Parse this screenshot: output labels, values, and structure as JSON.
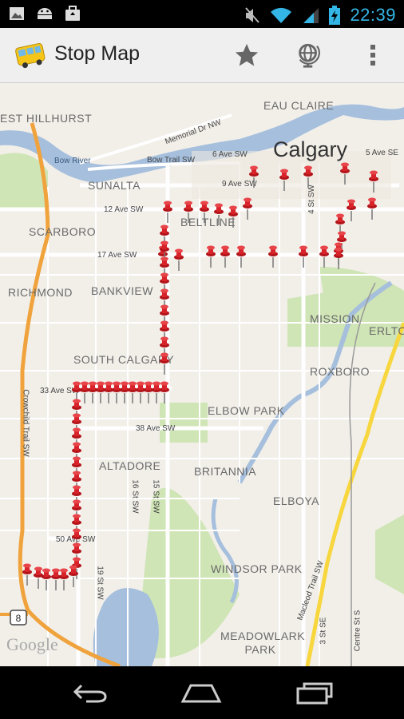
{
  "status_bar": {
    "time": "22:39",
    "left_icons": [
      "gallery-icon",
      "android-icon",
      "briefcase-icon"
    ],
    "right_icons": [
      "mute-icon",
      "wifi-icon",
      "signal-icon",
      "battery-charging-icon"
    ]
  },
  "action_bar": {
    "title": "Stop Map",
    "icons": [
      "bus-app-icon",
      "star-icon",
      "globe-icon",
      "overflow-menu-icon"
    ]
  },
  "map": {
    "city": "Calgary",
    "neighborhoods": [
      "EAU CLAIRE",
      "EST HILLHURST",
      "SUNALTA",
      "BELTLINE",
      "SCARBORO",
      "RICHMOND",
      "BANKVIEW",
      "MISSION",
      "ERLTON",
      "SOUTH CALGARY",
      "ROXBORO",
      "ELBOW PARK",
      "ALTADORE",
      "BRITANNIA",
      "ELBOYA",
      "WINDSOR PARK",
      "MEADOWLARK PARK"
    ],
    "streets": [
      "Bow River",
      "Memorial Dr NW",
      "Bow Trail SW",
      "6 Ave SW",
      "5 Ave SE",
      "9 Ave SW",
      "12 Ave SW",
      "17 Ave SW",
      "33 Ave SW",
      "38 Ave SW",
      "50 Ave SW",
      "Crowchild Trail SW",
      "16 St SW",
      "15 St SW",
      "19 St SW",
      "4 St SW",
      "Macleod Trail SW",
      "3 St SE",
      "Centre St S"
    ],
    "highway_shield": "8",
    "attribution": "Google",
    "stop_marker_icon": "red-pushpin-icon"
  },
  "nav_bar": {
    "buttons": [
      "back-icon",
      "home-icon",
      "recent-apps-icon"
    ]
  }
}
